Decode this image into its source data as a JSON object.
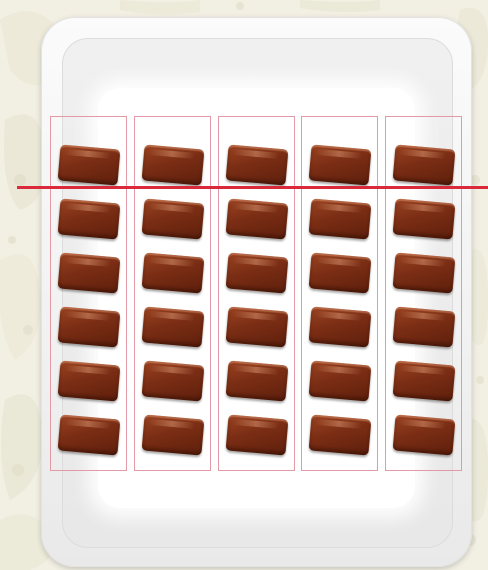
{
  "scene": {
    "groups": 5,
    "pieces_per_group": 6,
    "line_color": "#d9293a",
    "box_color": "#e39aa7",
    "chocolate_color": "#7a2d14"
  }
}
